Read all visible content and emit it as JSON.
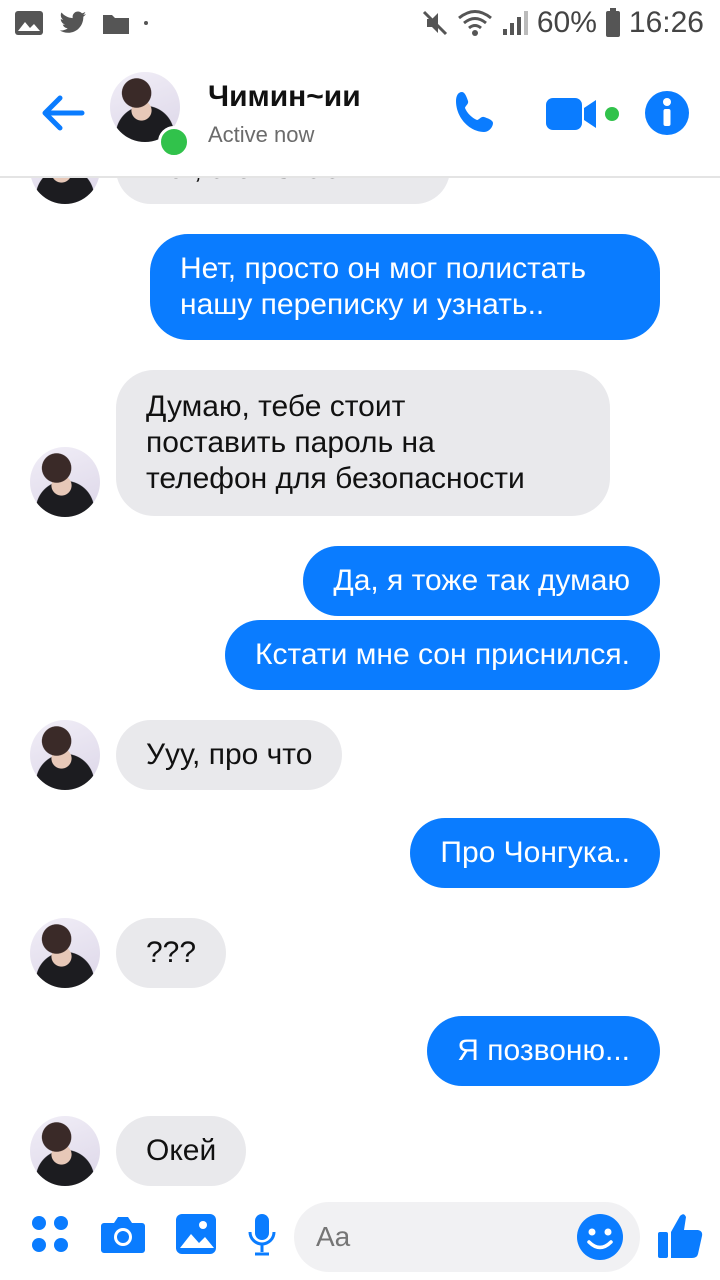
{
  "status_bar": {
    "battery_percent": "60%",
    "time": "16:26"
  },
  "header": {
    "contact_name": "Чимин~ии",
    "contact_status": "Active now"
  },
  "messages": [
    {
      "from": "them",
      "text": "Нет, а он знает????"
    },
    {
      "from": "me",
      "lines": [
        "Нет, просто он мог полистать",
        "нашу переписку и узнать.."
      ]
    },
    {
      "from": "them",
      "lines": [
        "Думаю, тебе стоит",
        "поставить пароль на",
        "телефон для безопасности"
      ]
    },
    {
      "from": "me",
      "text": "Да, я тоже так думаю"
    },
    {
      "from": "me",
      "text": "Кстати мне сон приснился."
    },
    {
      "from": "them",
      "text": "Ууу, про что"
    },
    {
      "from": "me",
      "text": "Про Чонгука.."
    },
    {
      "from": "them",
      "text": "???"
    },
    {
      "from": "me",
      "text": "Я позвоню..."
    },
    {
      "from": "them",
      "text": "Окей"
    }
  ],
  "composer": {
    "placeholder": "Aa"
  },
  "colors": {
    "accent": "#0a7cff",
    "received_bubble": "#e9e9ec",
    "online": "#31c24b"
  }
}
